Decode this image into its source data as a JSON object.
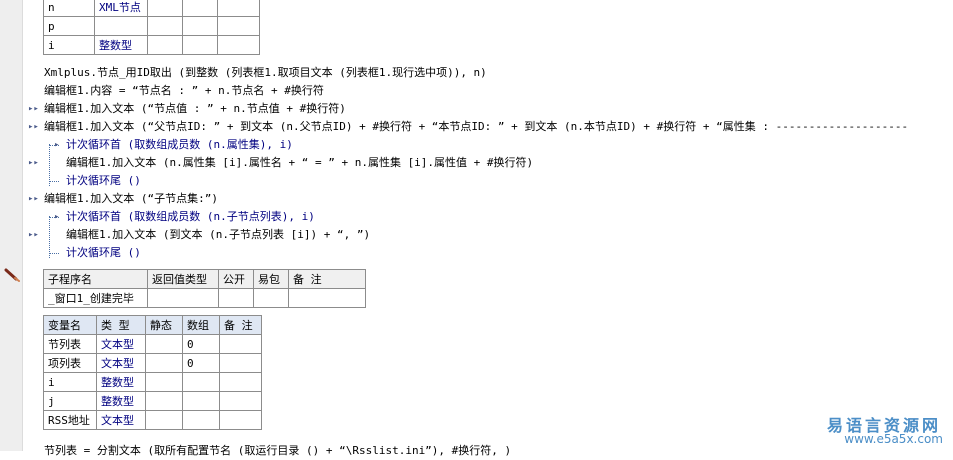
{
  "top_table": {
    "rows": [
      {
        "name": "n",
        "type": "XML节点"
      },
      {
        "name": "p",
        "type": ""
      },
      {
        "name": "i",
        "type": "整数型"
      }
    ]
  },
  "code1": {
    "l1": "Xmlplus.节点_用ID取出 (到整数 (列表框1.取项目文本 (列表框1.现行选中项)), n)",
    "l2": "编辑框1.内容 = “节点名 : ” + n.节点名 + #换行符",
    "l3": "编辑框1.加入文本 (“节点值 : ” + n.节点值 + #换行符)",
    "l4": "编辑框1.加入文本 (“父节点ID: ” + 到文本 (n.父节点ID) + #换行符 + “本节点ID: ” + 到文本 (n.本节点ID) + #换行符 + “属性集 : --------------------",
    "l5": "计次循环首 (取数组成员数 (n.属性集), i)",
    "l6": "编辑框1.加入文本 (n.属性集 [i].属性名 + “ = ” + n.属性集 [i].属性值 + #换行符)",
    "l7": "计次循环尾 ()",
    "l8": "编辑框1.加入文本 (“子节点集:”)",
    "l9": "计次循环首 (取数组成员数 (n.子节点列表), i)",
    "l10": "编辑框1.加入文本 (到文本 (n.子节点列表 [i]) + “, ”)",
    "l11": "计次循环尾 ()"
  },
  "sub_table": {
    "headers": [
      "子程序名",
      "返回值类型",
      "公开",
      "易包",
      "备 注"
    ],
    "name": "_窗口1_创建完毕"
  },
  "var_table": {
    "headers": [
      "变量名",
      "类 型",
      "静态",
      "数组",
      "备 注"
    ],
    "rows": [
      {
        "name": "节列表",
        "type": "文本型",
        "array": "0"
      },
      {
        "name": "项列表",
        "type": "文本型",
        "array": "0"
      },
      {
        "name": "i",
        "type": "整数型",
        "array": ""
      },
      {
        "name": "j",
        "type": "整数型",
        "array": ""
      },
      {
        "name": "RSS地址",
        "type": "文本型",
        "array": ""
      }
    ]
  },
  "bottom_line": "节列表 = 分割文本 (取所有配置节名 (取运行目录 () + “\\Rsslist.ini”), #换行符, )",
  "watermark": {
    "name": "易语言资源网",
    "url": "www.e5a5x.com"
  }
}
